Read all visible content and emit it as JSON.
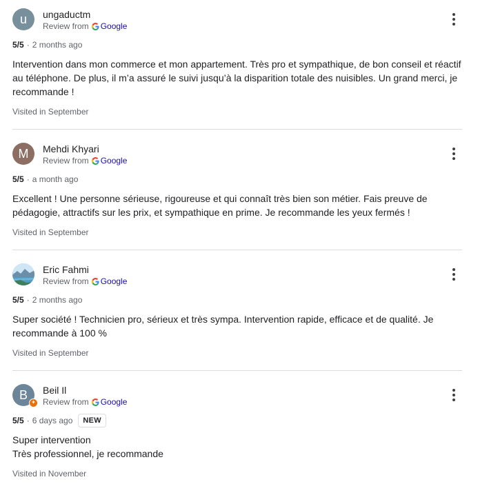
{
  "reviews": [
    {
      "avatar_letter": "u",
      "avatar_color": "#78909c",
      "name": "ungaductm",
      "source_label": "Review from",
      "source_name": "Google",
      "rating": "5/5",
      "time": "2 months ago",
      "text_lines": [
        "Intervention dans mon commerce et mon appartement. Très pro et sympathique, de bon conseil et réactif au téléphone. De plus, il m’a assuré le suivi jusqu’à la disparition totale des nuisibles. Un grand merci, je recommande !"
      ],
      "visited": "Visited in September"
    },
    {
      "avatar_letter": "M",
      "avatar_color": "#8d6e63",
      "name": "Mehdi Khyari",
      "source_label": "Review from",
      "source_name": "Google",
      "rating": "5/5",
      "time": "a month ago",
      "text_lines": [
        "Excellent ! Une personne sérieuse, rigoureuse et qui connaît très bien son métier. Fais preuve de pédagogie, attractifs sur les prix, et sympathique en prime. Je recommande les yeux fermés !"
      ],
      "visited": "Visited in September"
    },
    {
      "avatar_letter": "",
      "avatar_color": "#7fb3d5",
      "name": "Eric Fahmi",
      "source_label": "Review from",
      "source_name": "Google",
      "rating": "5/5",
      "time": "2 months ago",
      "text_lines": [
        "Super société ! Technicien pro, sérieux et très sympa. Intervention rapide, efficace et de qualité. Je recommande à 100 %"
      ],
      "visited": "Visited in September"
    },
    {
      "avatar_letter": "B",
      "avatar_color": "#6d8599",
      "name": "Beil Il",
      "source_label": "Review from",
      "source_name": "Google",
      "rating": "5/5",
      "time": "6 days ago",
      "badge": "NEW",
      "text_lines": [
        "Super intervention",
        "Très professionnel, je recommande"
      ],
      "visited": "Visited in November"
    }
  ],
  "icons": {
    "more": "more-vert-icon",
    "source": "google-g-icon",
    "local_guide": "local-guide-star-icon"
  },
  "colors": {
    "text_primary": "#202124",
    "text_secondary": "#5f6368",
    "link": "#1a0dab",
    "divider": "#dadce0",
    "local_guide_badge": "#e8710a"
  }
}
